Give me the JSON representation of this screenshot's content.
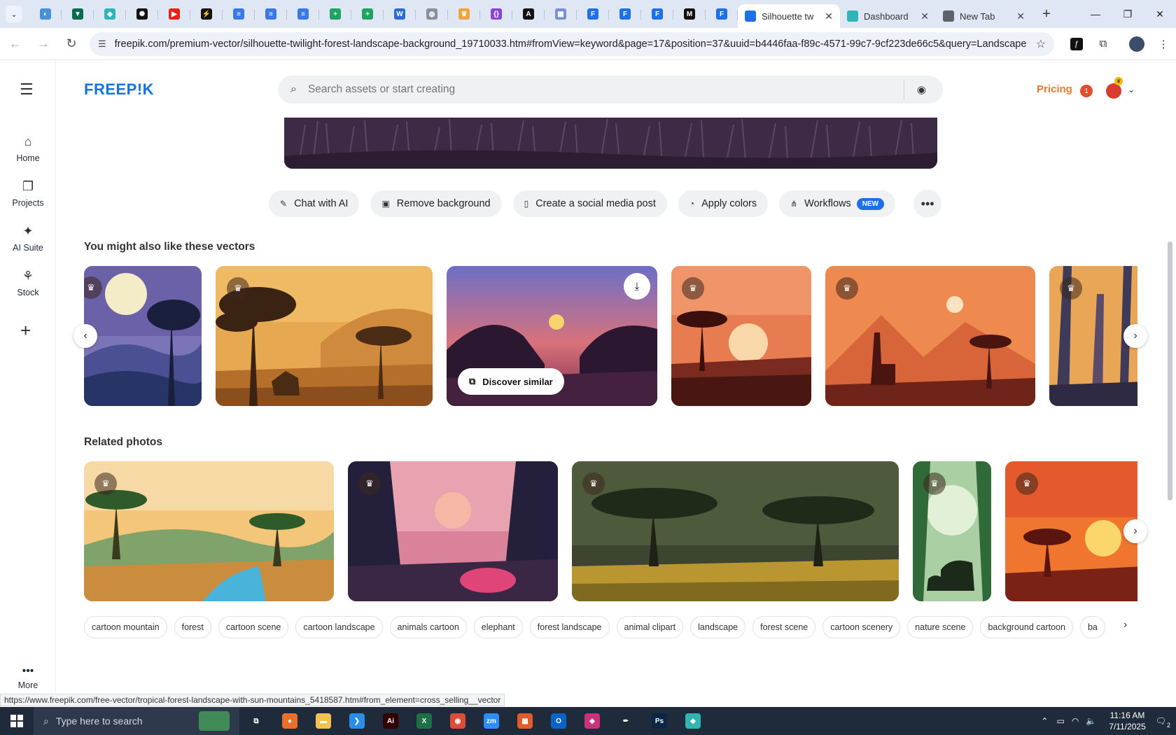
{
  "browser": {
    "pinned_tabs": [
      {
        "icon": "edge-icon",
        "color": "#4a90d9",
        "glyph": "◐"
      },
      {
        "icon": "vpn-icon",
        "color": "#0b6b4f",
        "glyph": "▼"
      },
      {
        "icon": "app-icon",
        "color": "#2cb6b6",
        "glyph": "◆"
      },
      {
        "icon": "chatgpt-icon",
        "color": "#111111",
        "glyph": "✺"
      },
      {
        "icon": "youtube-icon",
        "color": "#e62117",
        "glyph": "▶"
      },
      {
        "icon": "bolt-icon",
        "color": "#111111",
        "glyph": "⚡"
      },
      {
        "icon": "docs-icon",
        "color": "#3b78e7",
        "glyph": "≡"
      },
      {
        "icon": "docs-icon",
        "color": "#3b78e7",
        "glyph": "≡"
      },
      {
        "icon": "docs-icon",
        "color": "#3b78e7",
        "glyph": "≡"
      },
      {
        "icon": "sheets-icon",
        "color": "#1ea362",
        "glyph": "+"
      },
      {
        "icon": "sheets-icon",
        "color": "#1ea362",
        "glyph": "+"
      },
      {
        "icon": "word-icon",
        "color": "#2b6cd4",
        "glyph": "W"
      },
      {
        "icon": "globe-icon",
        "color": "#8a8f98",
        "glyph": "◍"
      },
      {
        "icon": "crown-icon",
        "color": "#f2a33a",
        "glyph": "♛"
      },
      {
        "icon": "code-icon",
        "color": "#8b44d6",
        "glyph": "{}"
      },
      {
        "icon": "a-icon",
        "color": "#111111",
        "glyph": "A"
      },
      {
        "icon": "grid-icon",
        "color": "#7a8fd0",
        "glyph": "▦"
      },
      {
        "icon": "freepik-icon",
        "color": "#1f6fec",
        "glyph": "F"
      },
      {
        "icon": "freepik-icon",
        "color": "#1f6fec",
        "glyph": "F"
      },
      {
        "icon": "freepik-icon",
        "color": "#1f6fec",
        "glyph": "F"
      },
      {
        "icon": "m-icon",
        "color": "#111111",
        "glyph": "M"
      },
      {
        "icon": "freepik-icon",
        "color": "#1f6fec",
        "glyph": "F"
      }
    ],
    "tabs": [
      {
        "title": "Silhouette tw",
        "active": true,
        "icon": "freepik-icon",
        "color": "#1f6fec"
      },
      {
        "title": "Dashboard",
        "active": false,
        "icon": "dashboard-icon",
        "color": "#2cb6b6"
      },
      {
        "title": "New Tab",
        "active": false,
        "icon": "chrome-icon",
        "color": "#5f6368"
      }
    ],
    "url": "freepik.com/premium-vector/silhouette-twilight-forest-landscape-background_19710033.htm#fromView=keyword&page=17&position=37&uuid=b4446faa-f89c-4571-99c7-9cf223de66c5&query=Landscape",
    "status_url": "https://www.freepik.com/free-vector/tropical-forest-landscape-with-sun-mountains_5418587.htm#from_element=cross_selling__vector"
  },
  "rail": {
    "items": [
      {
        "label": "Home",
        "icon": "home-icon",
        "glyph": "⌂"
      },
      {
        "label": "Projects",
        "icon": "projects-icon",
        "glyph": "❐"
      },
      {
        "label": "AI Suite",
        "icon": "sparkle-icon",
        "glyph": "✦"
      },
      {
        "label": "Stock",
        "icon": "stock-icon",
        "glyph": "⚘"
      }
    ],
    "more_label": "More"
  },
  "header": {
    "logo": "FREEP!K",
    "search_placeholder": "Search assets or start creating",
    "pricing": "Pricing",
    "notification_count": "1"
  },
  "actions": [
    {
      "label": "Chat with AI",
      "icon": "chat-icon",
      "glyph": "✎"
    },
    {
      "label": "Remove background",
      "icon": "remove-bg-icon",
      "glyph": "▣"
    },
    {
      "label": "Create a social media post",
      "icon": "phone-icon",
      "glyph": "▯"
    },
    {
      "label": "Apply colors",
      "icon": "palette-icon",
      "glyph": "◔"
    },
    {
      "label": "Workflows",
      "icon": "workflow-icon",
      "glyph": "⋔",
      "badge": "NEW"
    }
  ],
  "vectors_section": {
    "title": "You might also like these vectors",
    "discover_label": "Discover similar"
  },
  "photos_section": {
    "title": "Related photos"
  },
  "tags": [
    "cartoon mountain",
    "forest",
    "cartoon scene",
    "cartoon landscape",
    "animals cartoon",
    "elephant",
    "forest landscape",
    "animal clipart",
    "landscape",
    "forest scene",
    "cartoon scenery",
    "nature scene",
    "background cartoon",
    "ba"
  ],
  "taskbar": {
    "search_placeholder": "Type here to search",
    "time": "11:16 AM",
    "date": "7/11/2025",
    "notification_count": "2",
    "apps": [
      {
        "icon": "task-view-icon",
        "color": "#1f2a3a",
        "glyph": "⧉"
      },
      {
        "icon": "firefox-icon",
        "color": "#e8702a",
        "glyph": "●"
      },
      {
        "icon": "file-explorer-icon",
        "color": "#f2c14e",
        "glyph": "▬"
      },
      {
        "icon": "vscode-icon",
        "color": "#2a8ee8",
        "glyph": "❯"
      },
      {
        "icon": "illustrator-icon",
        "color": "#330000",
        "glyph": "Ai"
      },
      {
        "icon": "excel-icon",
        "color": "#1d7044",
        "glyph": "X"
      },
      {
        "icon": "chrome-icon",
        "color": "#dd4b39",
        "glyph": "◉"
      },
      {
        "icon": "zoom-icon",
        "color": "#2d8cff",
        "glyph": "zm"
      },
      {
        "icon": "app-icon",
        "color": "#e45a2b",
        "glyph": "▦"
      },
      {
        "icon": "outlook-icon",
        "color": "#0a64c8",
        "glyph": "O"
      },
      {
        "icon": "app-icon",
        "color": "#c9327a",
        "glyph": "◈"
      },
      {
        "icon": "pen-icon",
        "color": "#1f2a3a",
        "glyph": "✒"
      },
      {
        "icon": "photoshop-icon",
        "color": "#0b2646",
        "glyph": "Ps"
      },
      {
        "icon": "app-icon",
        "color": "#2fb6b0",
        "glyph": "◆"
      }
    ]
  }
}
